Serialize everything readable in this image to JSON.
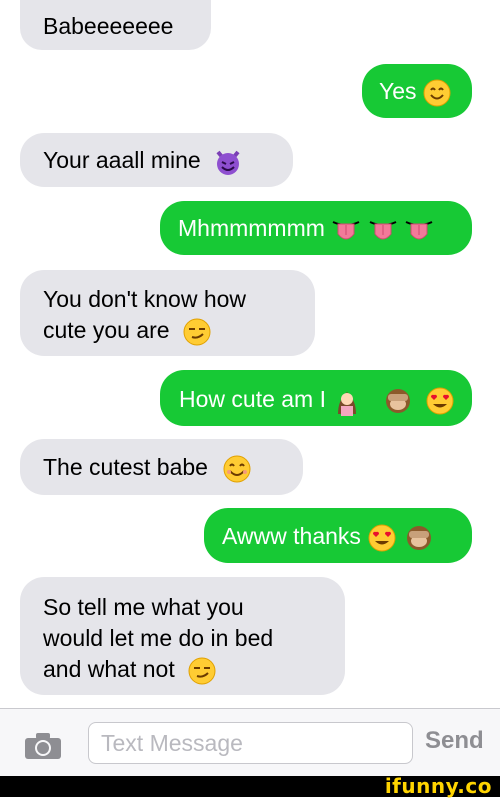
{
  "messages": [
    {
      "direction": "received",
      "lines": [
        "Babeeeeeee"
      ],
      "emoji": []
    },
    {
      "direction": "sent",
      "lines": [
        "Yes"
      ],
      "emoji": [
        "smiling-face"
      ]
    },
    {
      "direction": "received",
      "lines": [
        "Your aaall mine"
      ],
      "emoji": [
        "smiling-imp"
      ]
    },
    {
      "direction": "sent",
      "lines": [
        "Mhmmmmmm"
      ],
      "emoji": [
        "tongue",
        "tongue",
        "tongue"
      ]
    },
    {
      "direction": "received",
      "lines": [
        "You don't know how",
        "cute you are"
      ],
      "emoji": [
        "smirk"
      ]
    },
    {
      "direction": "sent",
      "lines": [
        "How cute am I"
      ],
      "emoji": [
        "information-desk-person",
        "see-no-evil-monkey",
        "heart-eyes"
      ]
    },
    {
      "direction": "received",
      "lines": [
        "The cutest babe"
      ],
      "emoji": [
        "smiling-face"
      ]
    },
    {
      "direction": "sent",
      "lines": [
        "Awww thanks"
      ],
      "emoji": [
        "heart-eyes",
        "see-no-evil-monkey"
      ]
    },
    {
      "direction": "received",
      "lines": [
        "So tell me what you",
        "would let me do in bed",
        "and what not"
      ],
      "emoji": [
        "smirk"
      ]
    }
  ],
  "composer": {
    "placeholder": "Text Message",
    "value": "",
    "send_label": "Send",
    "camera_icon": "camera-icon"
  },
  "footer": {
    "watermark": "ifunny.co"
  },
  "colors": {
    "sent_bubble": "#17c935",
    "received_bubble": "#e5e5ea",
    "send_disabled": "#8e8e93"
  }
}
